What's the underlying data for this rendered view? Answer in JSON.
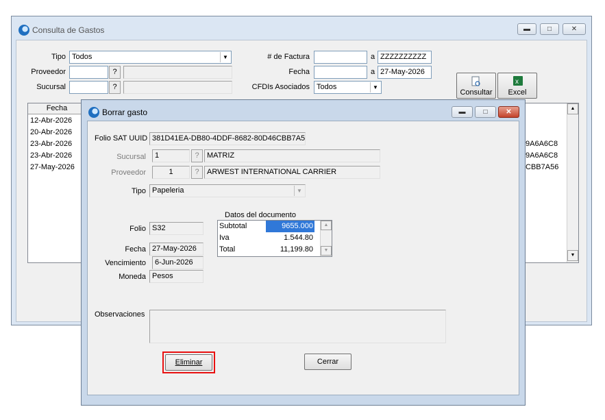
{
  "main": {
    "title": "Consulta de Gastos",
    "filters": {
      "tipo_label": "Tipo",
      "tipo_value": "Todos",
      "proveedor_label": "Proveedor",
      "proveedor_btn": "?",
      "sucursal_label": "Sucursal",
      "sucursal_btn": "?",
      "factura_label": "# de Factura",
      "factura_a": "a",
      "factura_to": "ZZZZZZZZZZ",
      "fecha_label": "Fecha",
      "fecha_a": "a",
      "fecha_to": "27-May-2026",
      "cfdi_label": "CFDIs Asociados",
      "cfdi_value": "Todos"
    },
    "buttons": {
      "consultar": "Consultar",
      "excel": "Excel"
    },
    "grid": {
      "header": "Fecha",
      "rows": [
        "12-Abr-2026",
        "20-Abr-2026",
        "23-Abr-2026",
        "23-Abr-2026",
        "27-May-2026"
      ],
      "right_cells": [
        "9A6A6C8",
        "9A6A6C8",
        "CBB7A56"
      ]
    }
  },
  "dialog": {
    "title": "Borrar gasto",
    "folio_sat_label": "Folio SAT UUID",
    "folio_sat_value": "381D41EA-DB80-4DDF-8682-80D46CBB7A56",
    "sucursal_label": "Sucursal",
    "sucursal_code": "1",
    "sucursal_btn": "?",
    "sucursal_name": "MATRIZ",
    "proveedor_label": "Proveedor",
    "proveedor_code": "1",
    "proveedor_btn": "?",
    "proveedor_name": "ARWEST INTERNATIONAL CARRIER",
    "tipo_label": "Tipo",
    "tipo_value": "Papeleria",
    "folio_label": "Folio",
    "folio_value": "S32",
    "fecha_label": "Fecha",
    "fecha_value": "27-May-2026",
    "vencimiento_label": "Vencimiento",
    "vencimiento_value": "6-Jun-2026",
    "moneda_label": "Moneda",
    "moneda_value": "Pesos",
    "datos_title": "Datos del documento",
    "datos_rows": [
      {
        "label": "Subtotal",
        "value": "9655.000"
      },
      {
        "label": "Iva",
        "value": "1.544.80"
      },
      {
        "label": "Total",
        "value": "11,199.80"
      }
    ],
    "observaciones_label": "Observaciones",
    "observaciones_value": "",
    "eliminar": "Eliminar",
    "cerrar": "Cerrar"
  },
  "colors": {
    "highlight": "#e81010",
    "selection": "#3078d8"
  }
}
